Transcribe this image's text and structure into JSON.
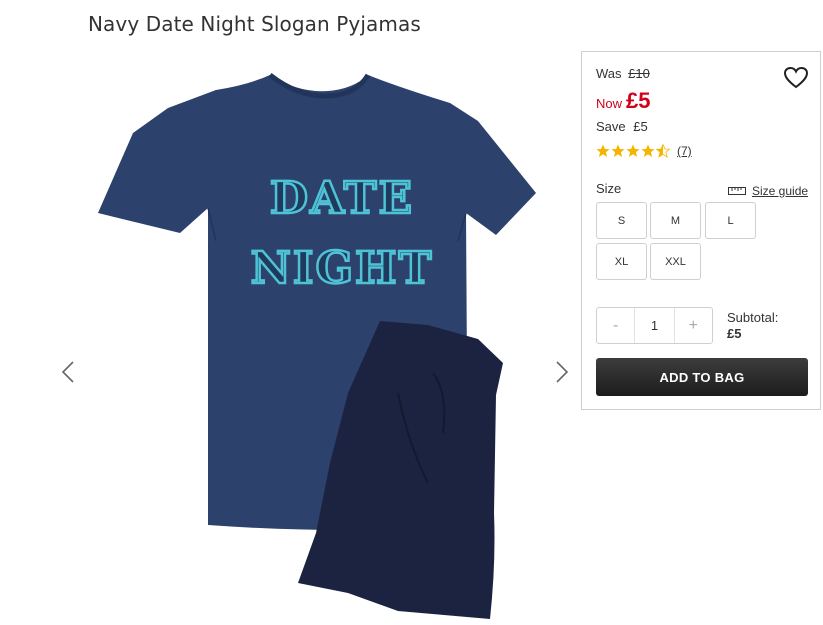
{
  "product": {
    "title": "Navy Date Night Slogan Pyjamas",
    "shirt_slogan_line1": "DATE",
    "shirt_slogan_line2": "NIGHT"
  },
  "gallery": {
    "prev_icon": "chevron-left-icon",
    "next_icon": "chevron-right-icon"
  },
  "pricing": {
    "was_label": "Was",
    "was_price": "£10",
    "now_label": "Now",
    "now_price": "£5",
    "save_label": "Save",
    "save_amount": "£5"
  },
  "rating": {
    "stars": 4.5,
    "max": 5,
    "review_count": "(7)"
  },
  "sizes": {
    "label": "Size",
    "guide_label": "Size guide",
    "options": [
      "S",
      "M",
      "L",
      "XL",
      "XXL"
    ]
  },
  "quantity": {
    "decrement": "-",
    "value": "1",
    "increment": "+"
  },
  "subtotal": {
    "label": "Subtotal:",
    "amount": "£5"
  },
  "cta": {
    "add_to_bag": "ADD TO BAG"
  },
  "colors": {
    "shirt": "#2b3f6b",
    "shorts": "#1a2240",
    "slogan": "#4fc3d6",
    "sale_red": "#d0021b",
    "star": "#f5b400",
    "button_dark": "#262626"
  }
}
